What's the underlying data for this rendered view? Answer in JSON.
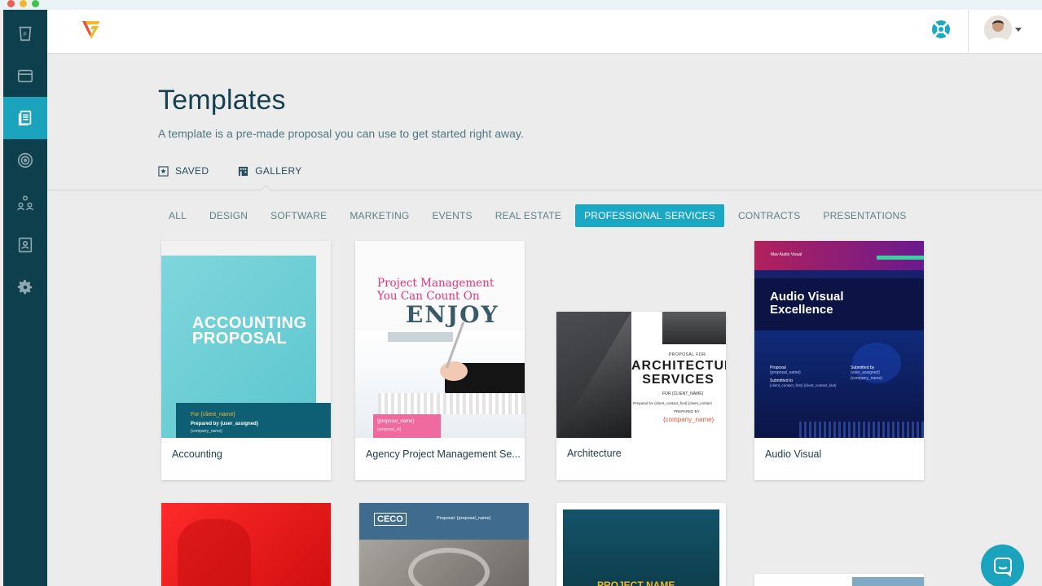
{
  "window": {
    "controls": [
      "close",
      "minimize",
      "maximize"
    ]
  },
  "sidebar": {
    "items": [
      {
        "icon": "coffee-cup-icon",
        "active": false
      },
      {
        "icon": "archive-box-icon",
        "active": false
      },
      {
        "icon": "templates-document-icon",
        "active": true
      },
      {
        "icon": "target-icon",
        "active": false
      },
      {
        "icon": "team-icon",
        "active": false
      },
      {
        "icon": "contacts-book-icon",
        "active": false
      },
      {
        "icon": "gear-icon",
        "active": false
      }
    ]
  },
  "topbar": {
    "logo_icon": "brand-g-logo",
    "help_icon": "lifebuoy-icon",
    "avatar_icon": "user-avatar"
  },
  "header": {
    "title": "Templates",
    "subtitle": "A template is a pre-made proposal you can use to get started right away."
  },
  "view_tabs": [
    {
      "label": "SAVED",
      "icon": "star-box-icon"
    },
    {
      "label": "GALLERY",
      "icon": "gallery-building-icon",
      "active": true
    }
  ],
  "categories": [
    {
      "label": "ALL"
    },
    {
      "label": "DESIGN"
    },
    {
      "label": "SOFTWARE"
    },
    {
      "label": "MARKETING"
    },
    {
      "label": "EVENTS"
    },
    {
      "label": "REAL ESTATE"
    },
    {
      "label": "PROFESSIONAL SERVICES",
      "active": true
    },
    {
      "label": "CONTRACTS"
    },
    {
      "label": "PRESENTATIONS"
    }
  ],
  "templates": [
    {
      "name": "Accounting",
      "thumb": {
        "title": "ACCOUNTING PROPOSAL",
        "line1": "For {client_name}",
        "line2": "Prepared by {user_assigned}",
        "line3": "{company_name}"
      }
    },
    {
      "name": "Agency Project Management Se...",
      "thumb": {
        "title": "Project Management You Can Count On",
        "bg_text": "ENJOY IT",
        "tag1": "{proposal_name}",
        "tag2": "{proposal_id}"
      }
    },
    {
      "name": "Architecture",
      "thumb": {
        "kicker": "PROPOSAL FOR",
        "title": "ARCHITECTUR SERVICES",
        "for": "FOR {CLIENT_NAME}",
        "prepared": "Prepared for {client_contact_first} {client_contact",
        "prepared_by": "PREPARED BY",
        "company": "{company_name}"
      }
    },
    {
      "name": "Audio Visual",
      "thumb": {
        "brand": "Mav Audio Visual",
        "title": "Audio Visual Excellence",
        "proposal": "Proposal",
        "proposal_name": "{proposal_name}",
        "submitted_to": "Submitted to",
        "client_line": "{client_contact_first} {client_contact_last}",
        "submitted_by": "Submitted by",
        "user_line": "{user_assigned}",
        "company_line": "{company_name}"
      }
    },
    {
      "name": "",
      "thumb": {}
    },
    {
      "name": "",
      "thumb": {
        "logo_text": "CECO",
        "proposal": "Proposal: {proposal_name}"
      }
    },
    {
      "name": "",
      "thumb": {
        "title": "PROJECT NAME"
      }
    },
    {
      "name": "",
      "thumb": {}
    }
  ],
  "colors": {
    "accent": "#1ba8c4",
    "sidebar": "#0e3f4d",
    "title": "#173f4f",
    "logo_yellow": "#f2b82c",
    "logo_red": "#e8543a"
  },
  "chat": {
    "icon": "chat-bubble-icon"
  }
}
